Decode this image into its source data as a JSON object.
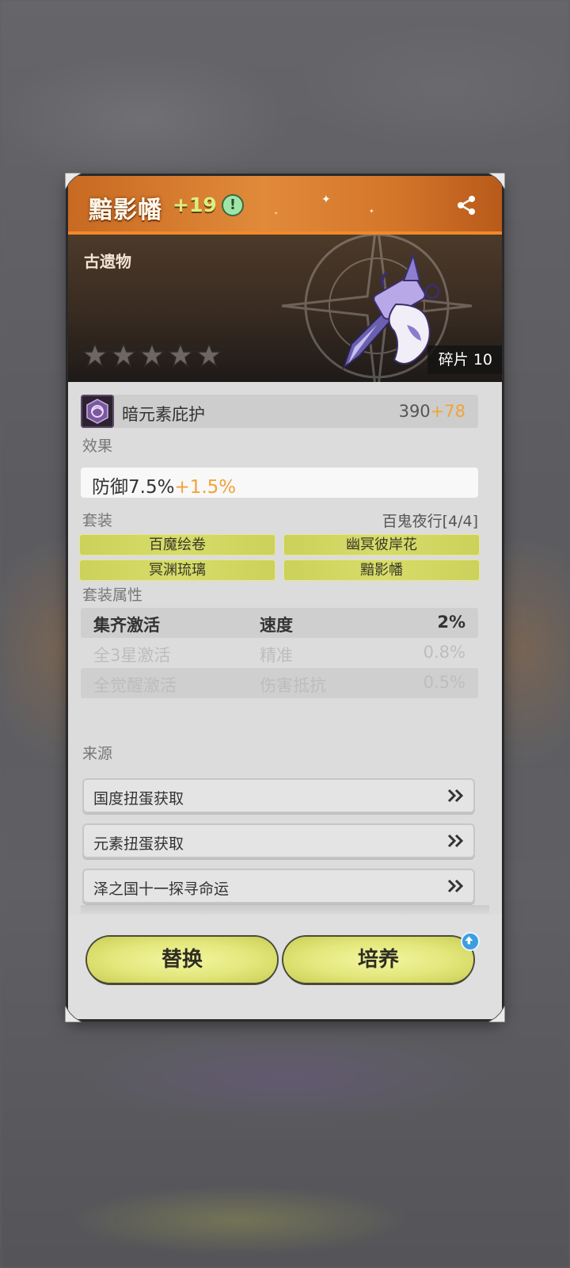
{
  "header": {
    "title": "黯影幡",
    "level": "+19",
    "info_icon": "!"
  },
  "hero": {
    "type_label": "古遗物",
    "stars_filled": 0,
    "stars_total": 5,
    "fragments_label": "碎片 10"
  },
  "main_stat": {
    "name": "暗元素庇护",
    "value": "390",
    "bonus": "+78"
  },
  "effect": {
    "label": "效果",
    "value": "防御7.5%",
    "bonus": "+1.5%"
  },
  "set": {
    "label": "套装",
    "name": "百鬼夜行[4/4]",
    "pieces": [
      "百魔绘卷",
      "幽冥彼岸花",
      "冥渊琉璃",
      "黯影幡"
    ]
  },
  "set_attributes": {
    "label": "套装属性",
    "rows": [
      {
        "condition": "集齐激活",
        "stat": "速度",
        "value": "2%"
      },
      {
        "condition": "全3星激活",
        "stat": "精准",
        "value": "0.8%"
      },
      {
        "condition": "全觉醒激活",
        "stat": "伤害抵抗",
        "value": "0.5%"
      }
    ]
  },
  "sources": {
    "label": "来源",
    "items": [
      "国度扭蛋获取",
      "元素扭蛋获取",
      "泽之国十一探寻命运"
    ]
  },
  "actions": {
    "replace_label": "替换",
    "train_label": "培养"
  },
  "colors": {
    "header_orange": "#e18a3a",
    "bonus_orange": "#f2a23a",
    "button_yellow": "#e2e67a",
    "badge_blue": "#3b9ee0"
  }
}
